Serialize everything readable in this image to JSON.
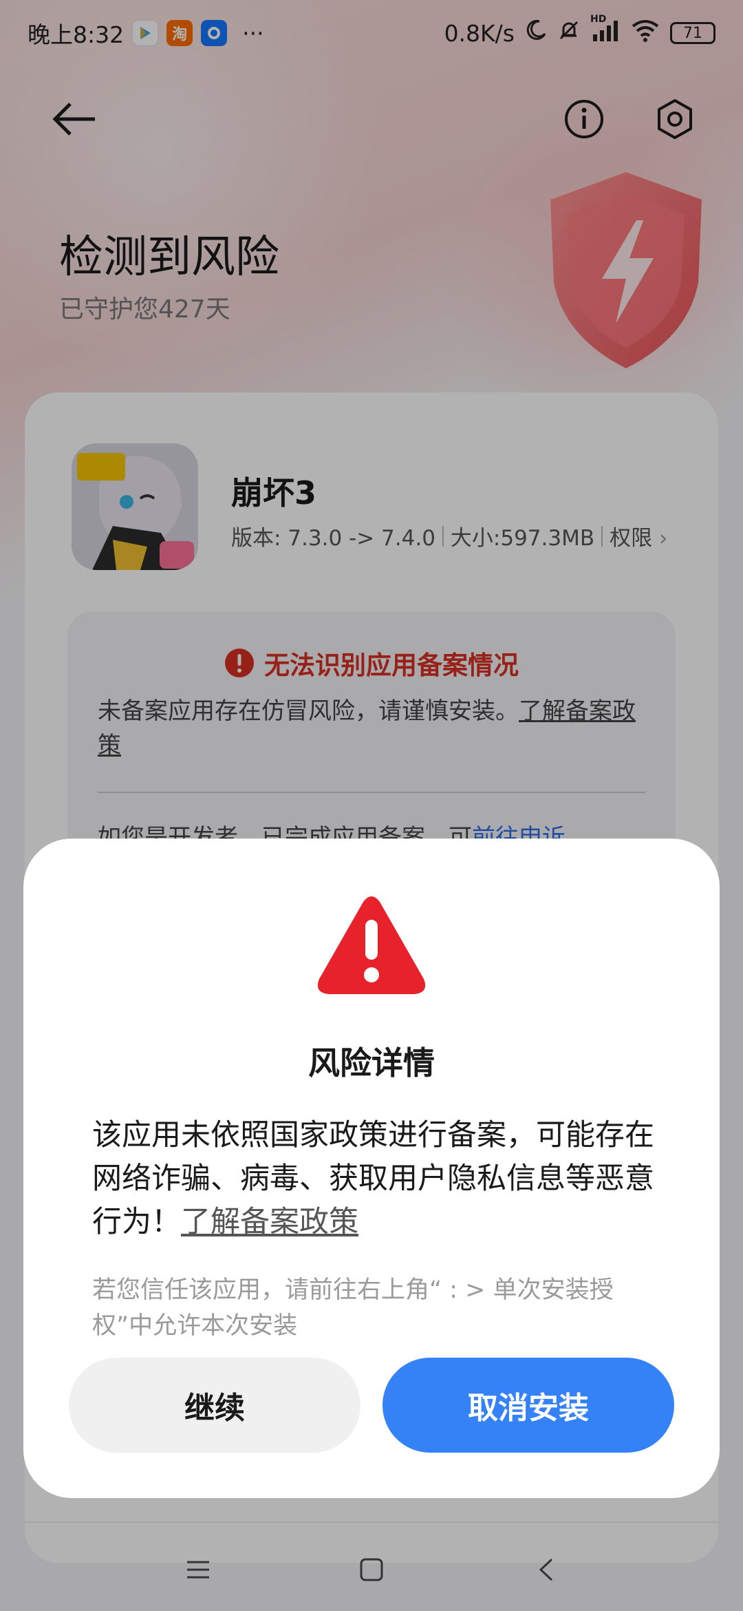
{
  "status_bar": {
    "time": "晚上8:32",
    "more": "···",
    "net_speed": "0.8K/s",
    "hd_label": "HD",
    "battery": "71",
    "taobao_glyph": "淘"
  },
  "header": {
    "title": "检测到风险",
    "subtitle": "已守护您427天"
  },
  "app": {
    "name": "崩坏3",
    "version": "版本: 7.3.0 -> 7.4.0",
    "size": "大小:597.3MB",
    "permissions": "权限",
    "permissions_arrow": "›"
  },
  "warning": {
    "heading": "无法识别应用备案情况",
    "text": "未备案应用存在仿冒风险，请谨慎安装。",
    "link": "了解备案政策",
    "text2_prefix": "如您是开发者，已完成应用备案，可",
    "text2_link": "前往申诉"
  },
  "dialog": {
    "title": "风险详情",
    "body": "该应用未依照国家政策进行备案，可能存在网络诈骗、病毒、获取用户隐私信息等恶意行为！",
    "body_link": "了解备案政策",
    "hint": "若您信任该应用，请前往右上角“ : > 单次安装授权”中允许本次安装",
    "continue_label": "继续",
    "cancel_label": "取消安装"
  },
  "colors": {
    "accent_blue": "#3482f6",
    "danger_red": "#e8222b",
    "warn_text_red": "#d93025"
  }
}
